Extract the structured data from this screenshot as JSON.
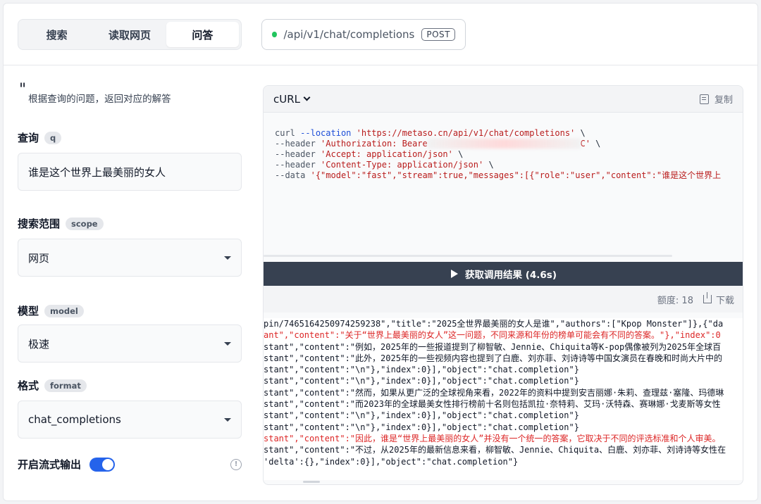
{
  "tabs": [
    {
      "label": "搜索",
      "active": false
    },
    {
      "label": "读取网页",
      "active": false
    },
    {
      "label": "问答",
      "active": true
    }
  ],
  "endpoint": {
    "path": "/api/v1/chat/completions",
    "method": "POST",
    "status_color": "#22c55e"
  },
  "description": "根据查询的问题，返回对应的解答",
  "fields": {
    "query": {
      "label": "查询",
      "key": "q",
      "value": "谁是这个世界上最美丽的女人"
    },
    "scope": {
      "label": "搜索范围",
      "key": "scope",
      "value": "网页"
    },
    "model": {
      "label": "模型",
      "key": "model",
      "value": "极速"
    },
    "format": {
      "label": "格式",
      "key": "format",
      "value": "chat_completions"
    },
    "stream": {
      "label": "开启流式输出",
      "enabled": true
    }
  },
  "code": {
    "language": "cURL",
    "copy_label": "复制",
    "lines": {
      "l1_cmd": "curl",
      "l1_flag": "--location",
      "l1_str": "'https://metaso.cn/api/v1/chat/completions'",
      "l1_tail": " \\",
      "l2_cmd": "--header",
      "l2_str_a": "'Authorization: Beare",
      "l2_str_b": "C'",
      "l2_tail": " \\",
      "l3_cmd": "--header",
      "l3_str": "'Accept: application/json'",
      "l3_tail": " \\",
      "l4_cmd": "--header",
      "l4_str": "'Content-Type: application/json'",
      "l4_tail": " \\",
      "l5_cmd": "--data",
      "l5_str": "'{\"model\":\"fast\",\"stream\":true,\"messages\":[{\"role\":\"user\",\"content\":\"谁是这个世界上"
    }
  },
  "run": {
    "label": "获取调用结果 (4.6s)"
  },
  "meta": {
    "quota": "额度: 18",
    "download_label": "下载"
  },
  "result_lines": [
    {
      "text": "pin/7465164250974259238\",\"title\":\"2025全世界最美丽的女人是谁\",\"authors\":[\"Kpop Monster\"]},{\"da",
      "red": false
    },
    {
      "text": "ant\",\"content\":\"关于“世界上最美丽的女人”这一问题，不同来源和年份的榜单可能会有不同的答案。\"},\"index\":0",
      "red": true
    },
    {
      "text": "stant\",\"content\":\"例如，2025年的一些报道提到了柳智敏、Jennie、Chiquita等K-pop偶像被列为2025年全球百",
      "red": false
    },
    {
      "text": "stant\",\"content\":\"此外，2025年的一些视频内容也提到了白鹿、刘亦菲、刘诗诗等中国女演员在春晚和时尚大片中的",
      "red": false
    },
    {
      "text": "stant\",\"content\":\"\\n\"},\"index\":0}],\"object\":\"chat.completion\"}",
      "red": false
    },
    {
      "text": "stant\",\"content\":\"\\n\"},\"index\":0}],\"object\":\"chat.completion\"}",
      "red": false
    },
    {
      "text": "stant\",\"content\":\"然而，如果从更广泛的全球视角来看，2022年的资料中提到安吉丽娜·朱莉、查理兹·塞隆、玛德琳",
      "red": false
    },
    {
      "text": "stant\",\"content\":\"而2023年的全球最美女性排行榜前十名则包括凯拉·奈特莉、艾玛·沃特森、赛琳娜·戈麦斯等女性",
      "red": false
    },
    {
      "text": "stant\",\"content\":\"\\n\"},\"index\":0}],\"object\":\"chat.completion\"}",
      "red": false
    },
    {
      "text": "stant\",\"content\":\"\\n\"},\"index\":0}],\"object\":\"chat.completion\"}",
      "red": false
    },
    {
      "text": "stant\",\"content\":\"因此，谁是“世界上最美丽的女人”并没有一个统一的答案，它取决于不同的评选标准和个人审美。",
      "red": true
    },
    {
      "text": "stant\",\"content\":\"不过，从2025年的最新信息来看，柳智敏、Jennie、Chiquita、白鹿、刘亦菲、刘诗诗等女性在",
      "red": false
    },
    {
      "text": "'delta':{},\"index\":0}],\"object\":\"chat.completion\"}",
      "red": false
    }
  ]
}
